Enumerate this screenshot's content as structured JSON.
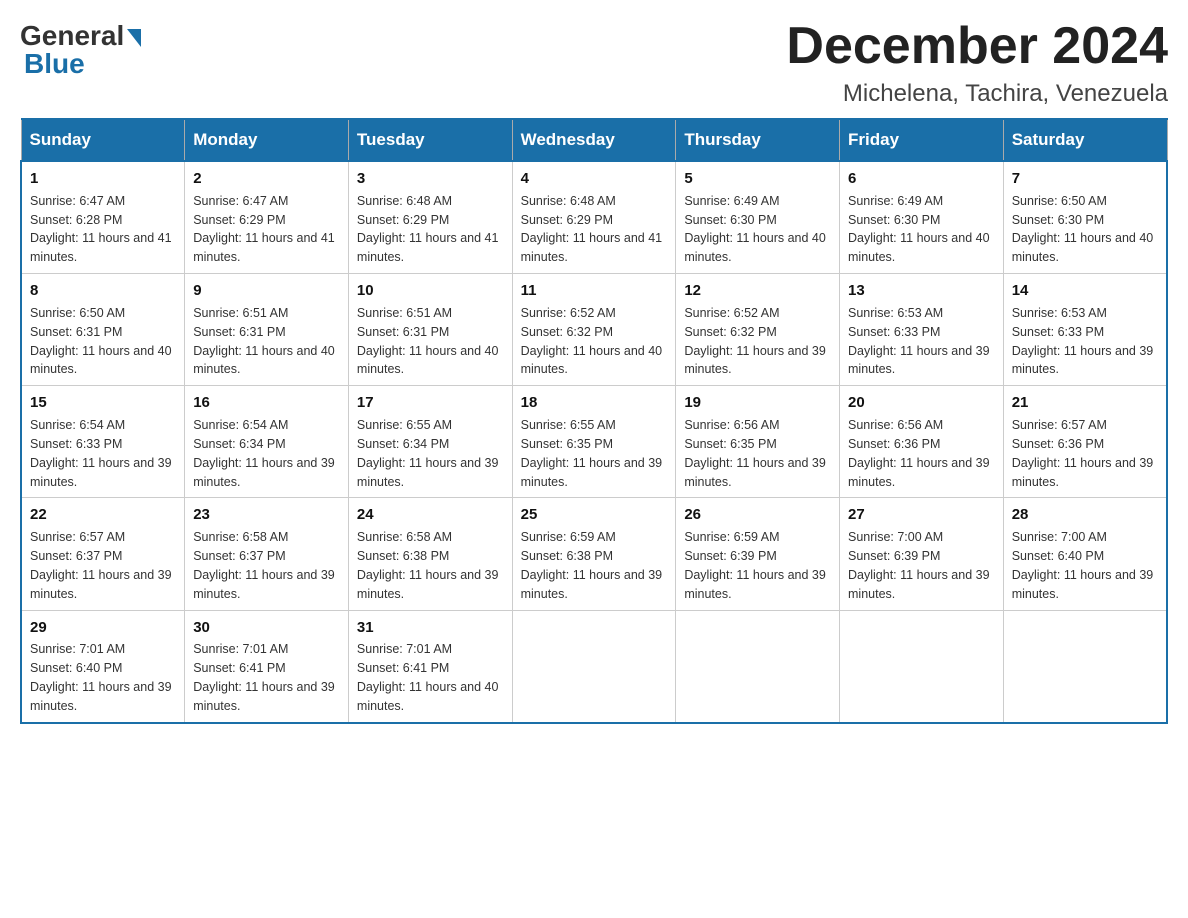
{
  "logo": {
    "general": "General",
    "blue": "Blue"
  },
  "title": "December 2024",
  "location": "Michelena, Tachira, Venezuela",
  "days_of_week": [
    "Sunday",
    "Monday",
    "Tuesday",
    "Wednesday",
    "Thursday",
    "Friday",
    "Saturday"
  ],
  "weeks": [
    [
      {
        "day": "1",
        "sunrise": "6:47 AM",
        "sunset": "6:28 PM",
        "daylight": "11 hours and 41 minutes."
      },
      {
        "day": "2",
        "sunrise": "6:47 AM",
        "sunset": "6:29 PM",
        "daylight": "11 hours and 41 minutes."
      },
      {
        "day": "3",
        "sunrise": "6:48 AM",
        "sunset": "6:29 PM",
        "daylight": "11 hours and 41 minutes."
      },
      {
        "day": "4",
        "sunrise": "6:48 AM",
        "sunset": "6:29 PM",
        "daylight": "11 hours and 41 minutes."
      },
      {
        "day": "5",
        "sunrise": "6:49 AM",
        "sunset": "6:30 PM",
        "daylight": "11 hours and 40 minutes."
      },
      {
        "day": "6",
        "sunrise": "6:49 AM",
        "sunset": "6:30 PM",
        "daylight": "11 hours and 40 minutes."
      },
      {
        "day": "7",
        "sunrise": "6:50 AM",
        "sunset": "6:30 PM",
        "daylight": "11 hours and 40 minutes."
      }
    ],
    [
      {
        "day": "8",
        "sunrise": "6:50 AM",
        "sunset": "6:31 PM",
        "daylight": "11 hours and 40 minutes."
      },
      {
        "day": "9",
        "sunrise": "6:51 AM",
        "sunset": "6:31 PM",
        "daylight": "11 hours and 40 minutes."
      },
      {
        "day": "10",
        "sunrise": "6:51 AM",
        "sunset": "6:31 PM",
        "daylight": "11 hours and 40 minutes."
      },
      {
        "day": "11",
        "sunrise": "6:52 AM",
        "sunset": "6:32 PM",
        "daylight": "11 hours and 40 minutes."
      },
      {
        "day": "12",
        "sunrise": "6:52 AM",
        "sunset": "6:32 PM",
        "daylight": "11 hours and 39 minutes."
      },
      {
        "day": "13",
        "sunrise": "6:53 AM",
        "sunset": "6:33 PM",
        "daylight": "11 hours and 39 minutes."
      },
      {
        "day": "14",
        "sunrise": "6:53 AM",
        "sunset": "6:33 PM",
        "daylight": "11 hours and 39 minutes."
      }
    ],
    [
      {
        "day": "15",
        "sunrise": "6:54 AM",
        "sunset": "6:33 PM",
        "daylight": "11 hours and 39 minutes."
      },
      {
        "day": "16",
        "sunrise": "6:54 AM",
        "sunset": "6:34 PM",
        "daylight": "11 hours and 39 minutes."
      },
      {
        "day": "17",
        "sunrise": "6:55 AM",
        "sunset": "6:34 PM",
        "daylight": "11 hours and 39 minutes."
      },
      {
        "day": "18",
        "sunrise": "6:55 AM",
        "sunset": "6:35 PM",
        "daylight": "11 hours and 39 minutes."
      },
      {
        "day": "19",
        "sunrise": "6:56 AM",
        "sunset": "6:35 PM",
        "daylight": "11 hours and 39 minutes."
      },
      {
        "day": "20",
        "sunrise": "6:56 AM",
        "sunset": "6:36 PM",
        "daylight": "11 hours and 39 minutes."
      },
      {
        "day": "21",
        "sunrise": "6:57 AM",
        "sunset": "6:36 PM",
        "daylight": "11 hours and 39 minutes."
      }
    ],
    [
      {
        "day": "22",
        "sunrise": "6:57 AM",
        "sunset": "6:37 PM",
        "daylight": "11 hours and 39 minutes."
      },
      {
        "day": "23",
        "sunrise": "6:58 AM",
        "sunset": "6:37 PM",
        "daylight": "11 hours and 39 minutes."
      },
      {
        "day": "24",
        "sunrise": "6:58 AM",
        "sunset": "6:38 PM",
        "daylight": "11 hours and 39 minutes."
      },
      {
        "day": "25",
        "sunrise": "6:59 AM",
        "sunset": "6:38 PM",
        "daylight": "11 hours and 39 minutes."
      },
      {
        "day": "26",
        "sunrise": "6:59 AM",
        "sunset": "6:39 PM",
        "daylight": "11 hours and 39 minutes."
      },
      {
        "day": "27",
        "sunrise": "7:00 AM",
        "sunset": "6:39 PM",
        "daylight": "11 hours and 39 minutes."
      },
      {
        "day": "28",
        "sunrise": "7:00 AM",
        "sunset": "6:40 PM",
        "daylight": "11 hours and 39 minutes."
      }
    ],
    [
      {
        "day": "29",
        "sunrise": "7:01 AM",
        "sunset": "6:40 PM",
        "daylight": "11 hours and 39 minutes."
      },
      {
        "day": "30",
        "sunrise": "7:01 AM",
        "sunset": "6:41 PM",
        "daylight": "11 hours and 39 minutes."
      },
      {
        "day": "31",
        "sunrise": "7:01 AM",
        "sunset": "6:41 PM",
        "daylight": "11 hours and 40 minutes."
      },
      null,
      null,
      null,
      null
    ]
  ],
  "labels": {
    "sunrise": "Sunrise:",
    "sunset": "Sunset:",
    "daylight": "Daylight:"
  }
}
